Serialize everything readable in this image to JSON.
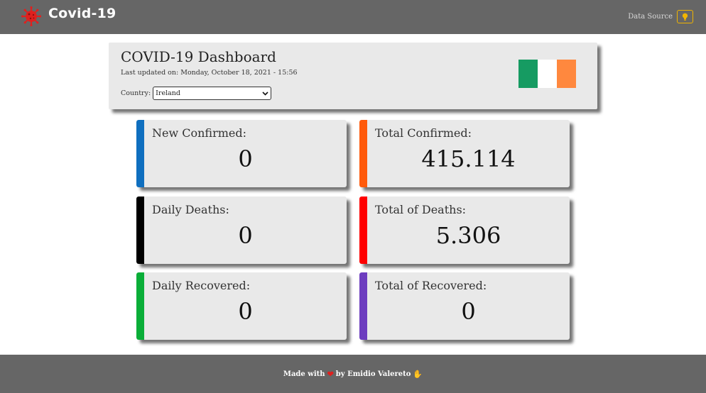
{
  "navbar": {
    "brand_icon": "virus-icon",
    "brand_color": "#e0201e",
    "title": "Covid-19",
    "data_source_label": "Data Source",
    "data_source_icon": "lightbulb-icon",
    "data_source_color": "#f0b400"
  },
  "header": {
    "title": "COVID-19 Dashboard",
    "last_updated": "Last updated on: Monday, October 18, 2021 - 15:56",
    "country_label": "Country:",
    "country_selected": "Ireland",
    "flag_colors": [
      "#169b62",
      "#ffffff",
      "#ff883e"
    ]
  },
  "cards": [
    {
      "label": "New Confirmed:",
      "value": "0",
      "color": "#0f6fbf"
    },
    {
      "label": "Total Confirmed:",
      "value": "415.114",
      "color": "#ff5a0a"
    },
    {
      "label": "Daily Deaths:",
      "value": "0",
      "color": "#000000"
    },
    {
      "label": "Total of Deaths:",
      "value": "5.306",
      "color": "#ff0000"
    },
    {
      "label": "Daily Recovered:",
      "value": "0",
      "color": "#0aae38"
    },
    {
      "label": "Total of Recovered:",
      "value": "0",
      "color": "#6d3dbf"
    }
  ],
  "footer": {
    "made_with": "Made with",
    "heart_icon": "heart-icon",
    "by_text": "by Emidio Valereto",
    "hand_icon": "waving-hand-icon"
  }
}
